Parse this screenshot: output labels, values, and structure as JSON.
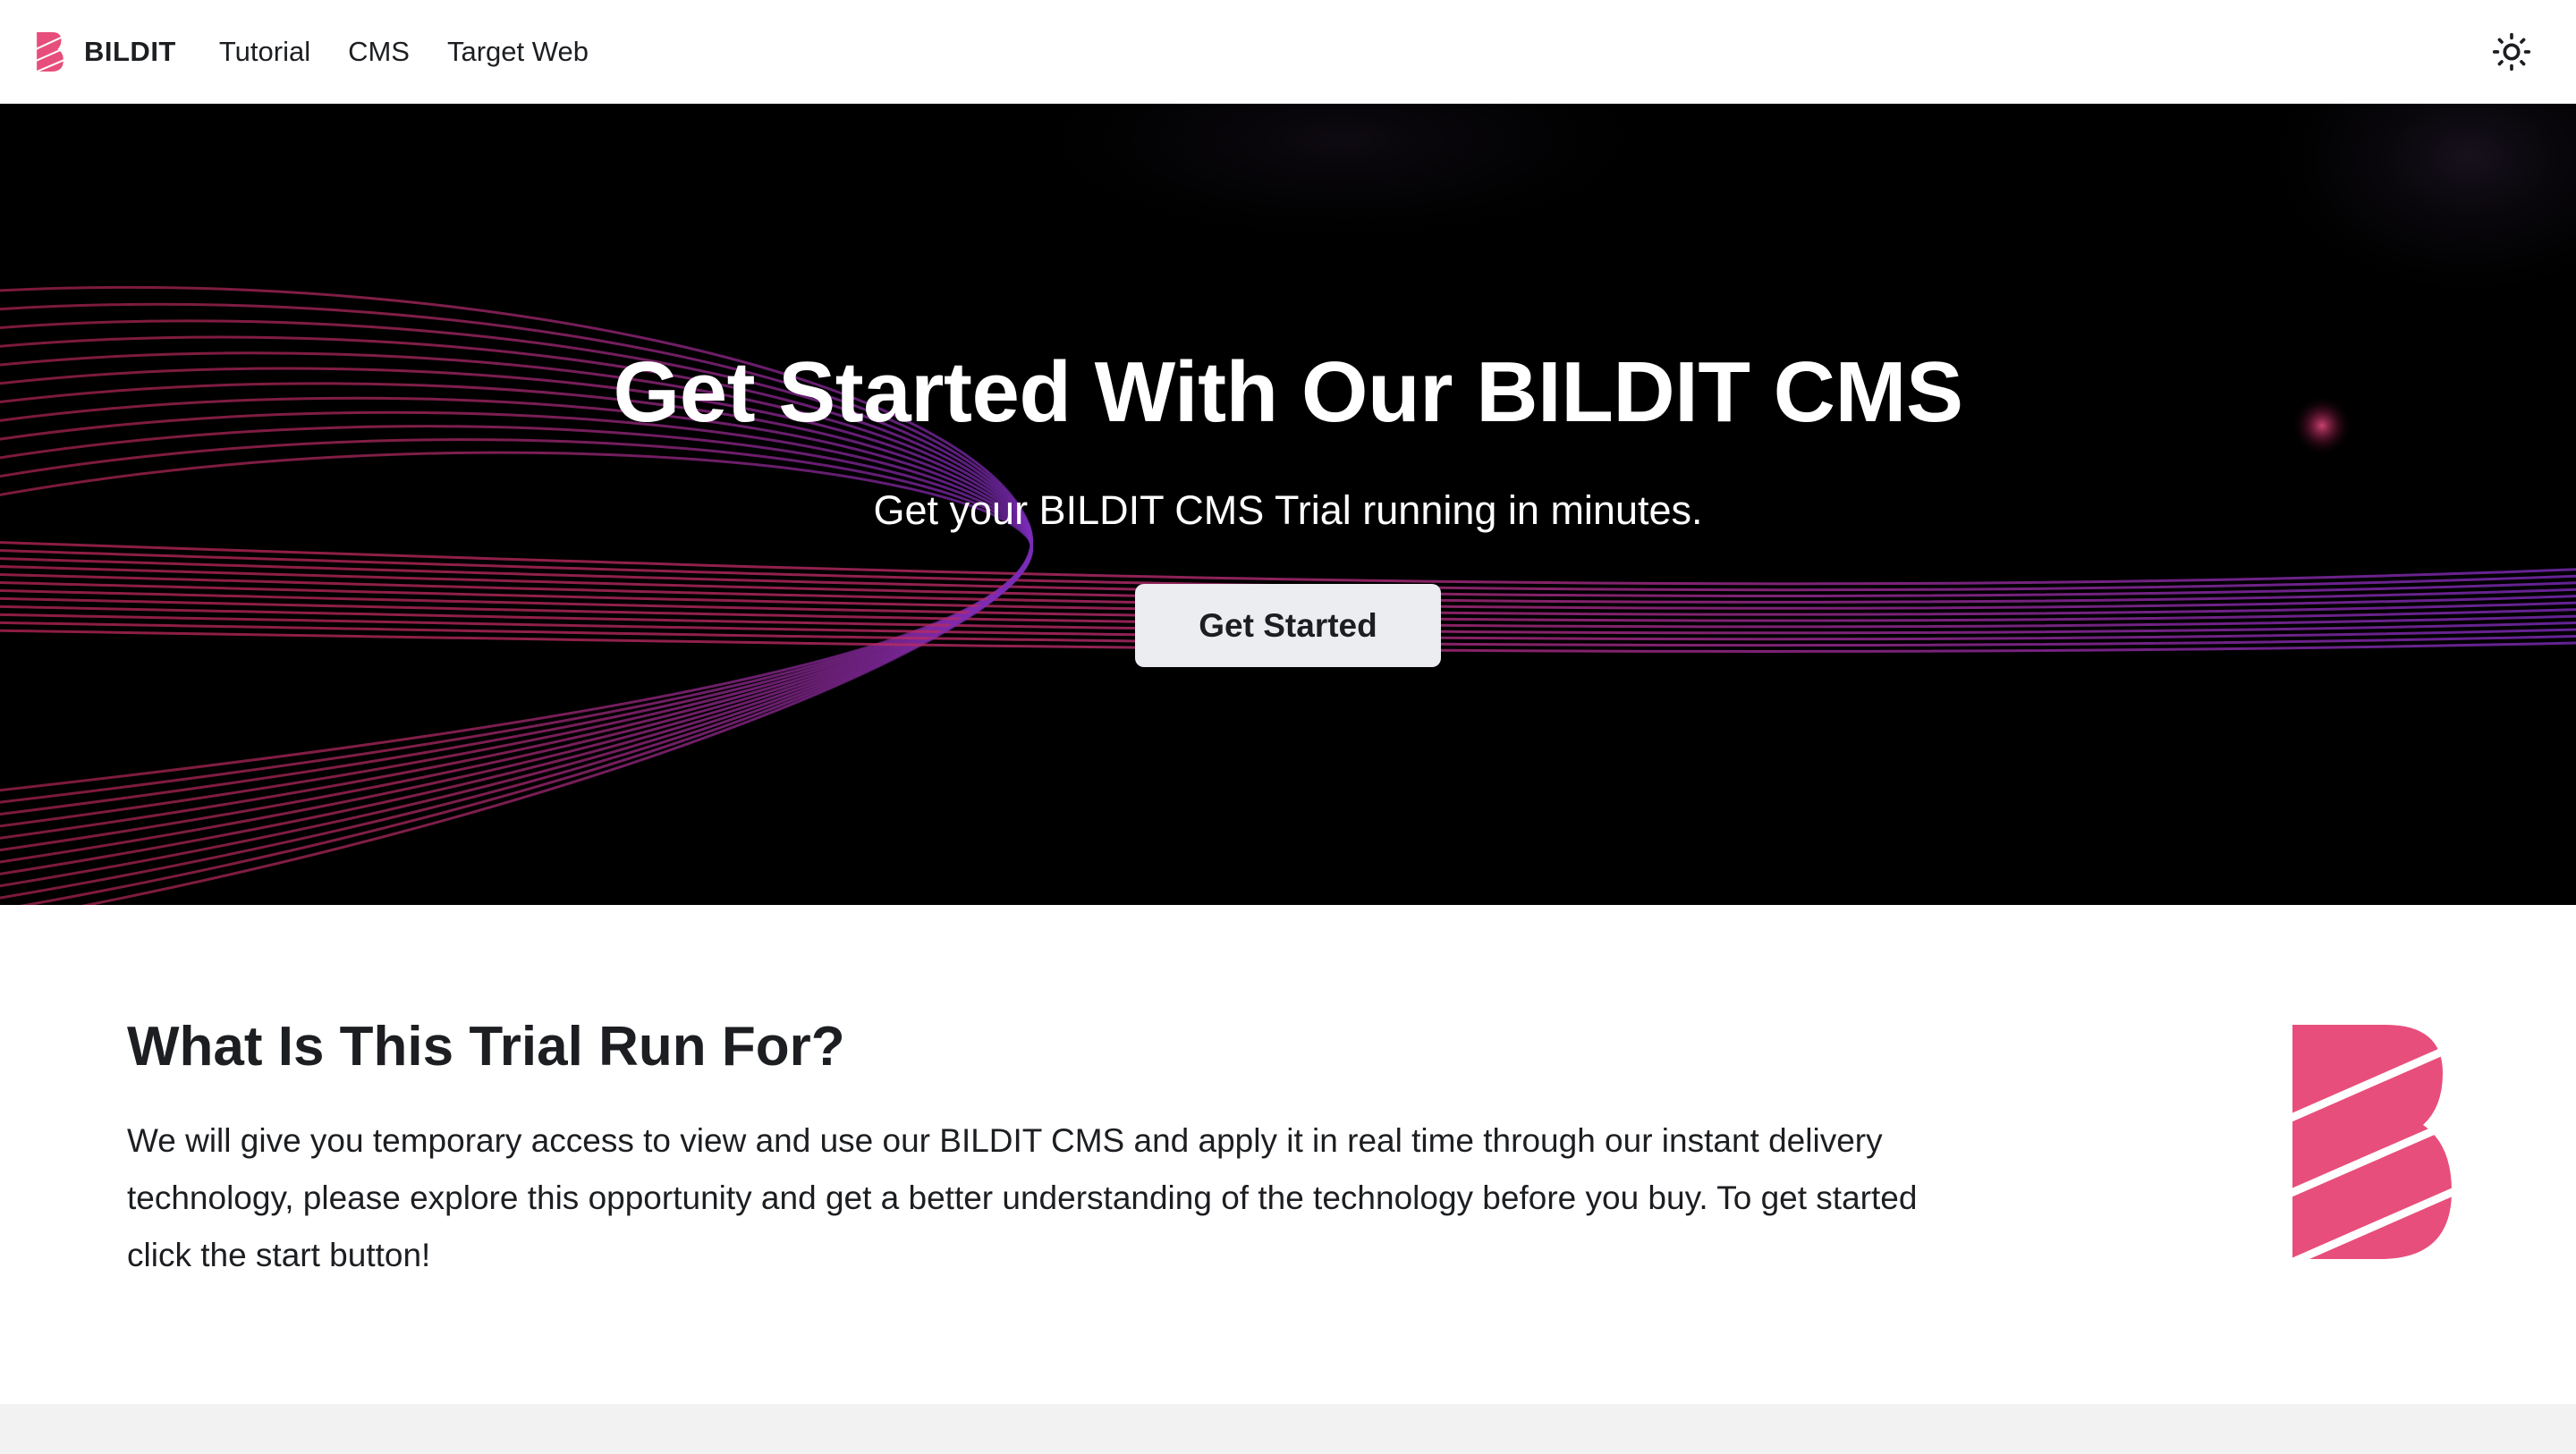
{
  "navbar": {
    "brand": "BILDIT",
    "links": [
      "Tutorial",
      "CMS",
      "Target Web"
    ],
    "theme_toggle_icon": "sun-icon"
  },
  "hero": {
    "title": "Get Started With Our BILDIT CMS",
    "subtitle": "Get your BILDIT CMS Trial running in minutes.",
    "button_label": "Get Started"
  },
  "features": {
    "heading": "What Is This Trial Run For?",
    "text": "We will give you temporary access to view and use our BILDIT CMS and apply it in real time through our instant delivery technology, please explore this opportunity and get a better understanding of the technology before you buy. To get started click the start button!",
    "logo_icon": "bildit-logo-icon"
  },
  "colors": {
    "brand_pink": "#e84e7b",
    "hero_background": "#000000",
    "line_pink": "#c2285a",
    "line_purple": "#7a2bb8",
    "button_bg": "#ebedf0",
    "footer_strip": "#f2f2f2"
  }
}
